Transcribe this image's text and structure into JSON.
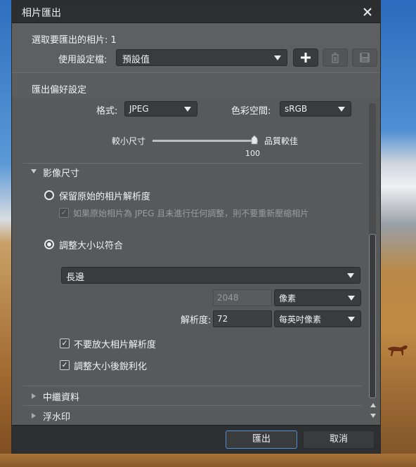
{
  "dialog": {
    "title": "相片匯出",
    "selected_label": "選取要匯出的相片: 1",
    "profile_label": "使用設定檔:",
    "profile_value": "預設值"
  },
  "preferences": {
    "header": "匯出偏好設定",
    "format_label": "格式:",
    "format_value": "JPEG",
    "colorspace_label": "色彩空間:",
    "colorspace_value": "sRGB",
    "slider_left_label": "較小尺寸",
    "slider_right_label": "品質較佳",
    "slider_value": "100",
    "quality_level": 1.0
  },
  "image_size": {
    "section_title": "影像尺寸",
    "keep_original_label": "保留原始的相片解析度",
    "no_recompress_label": "如果原始相片為 JPEG 且未進行任何調整，則不要重新壓縮相片",
    "resize_label": "調整大小以符合",
    "fit_option": "長邊",
    "size_value": "2048",
    "size_unit": "像素",
    "resolution_label": "解析度:",
    "resolution_value": "72",
    "resolution_unit": "每英吋像素",
    "no_enlarge_label": "不要放大相片解析度",
    "sharpen_label": "調整大小後銳利化"
  },
  "sections": {
    "metadata": "中繼資料",
    "watermark": "浮水印"
  },
  "footer": {
    "export_label": "匯出",
    "cancel_label": "取消"
  },
  "colors": {
    "accent": "#4e8fd6",
    "dialog_bg": "#595a5c",
    "titlebar_bg": "#2d2e30"
  }
}
